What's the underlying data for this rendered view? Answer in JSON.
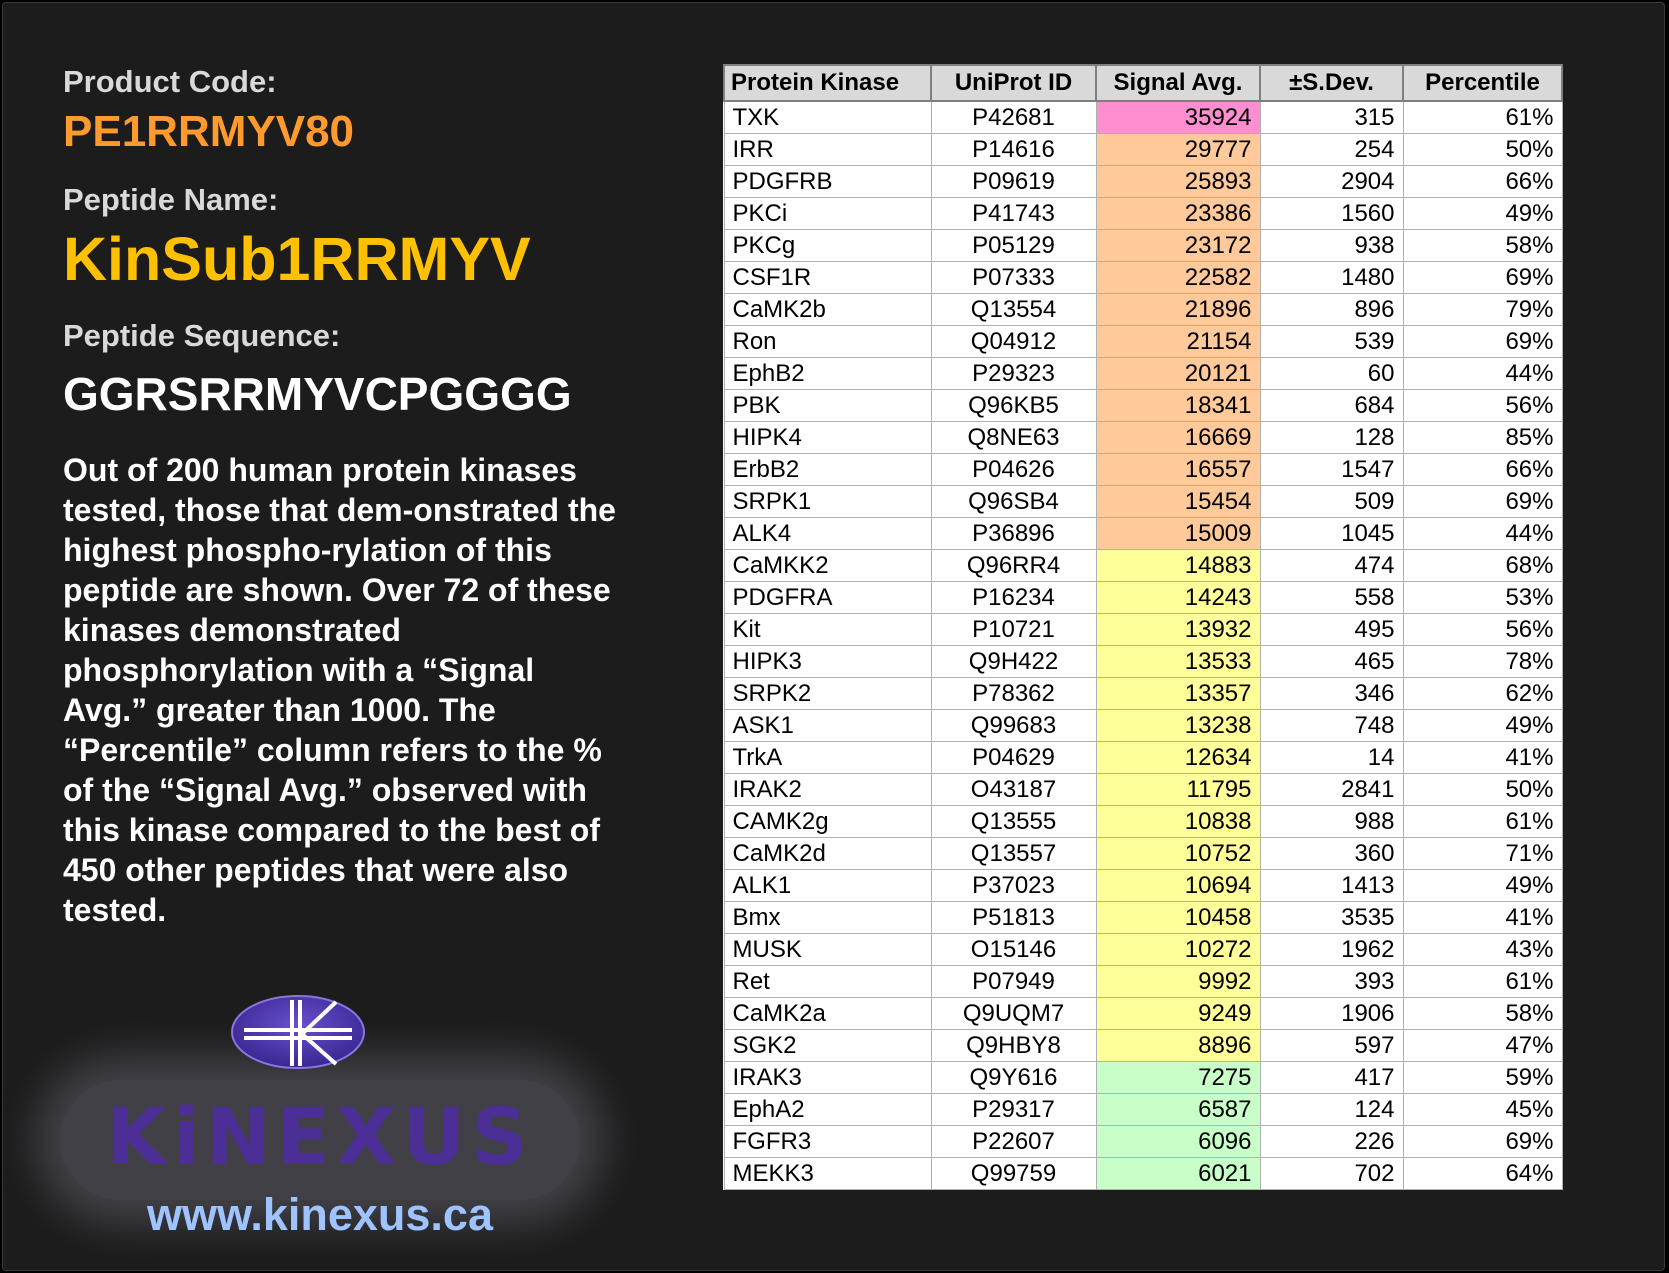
{
  "product": {
    "code_label": "Product Code:",
    "code": "PE1RRMYV80",
    "name_label": "Peptide Name:",
    "name": "KinSub1RRMYV",
    "sequence_label": "Peptide Sequence:",
    "sequence": "GGRSRRMYVCPGGGG",
    "description": "Out of 200 human protein kinases tested, those that dem-onstrated the highest phospho-rylation of this peptide are shown. Over 72 of these kinases demonstrated phosphorylation with a “Signal Avg.” greater than 1000. The “Percentile” column refers to the % of the “Signal Avg.” observed with this kinase compared to the best of 450 other peptides that were also tested."
  },
  "brand": {
    "logo_text": "KiNEXUS",
    "url": "www.kinexus.ca"
  },
  "colors": {
    "pink": "#ff8ed1",
    "orange": "#ffc99a",
    "yellow": "#ffff99",
    "green": "#c8ffc8"
  },
  "table": {
    "headers": [
      "Protein Kinase",
      "UniProt ID",
      "Signal Avg.",
      "±S.Dev.",
      "Percentile"
    ],
    "rows": [
      {
        "kinase": "TXK",
        "uniprot": "P42681",
        "signal": "35924",
        "sdev": "315",
        "pct": "61%",
        "color": "pink"
      },
      {
        "kinase": "IRR",
        "uniprot": "P14616",
        "signal": "29777",
        "sdev": "254",
        "pct": "50%",
        "color": "orange"
      },
      {
        "kinase": "PDGFRB",
        "uniprot": "P09619",
        "signal": "25893",
        "sdev": "2904",
        "pct": "66%",
        "color": "orange"
      },
      {
        "kinase": "PKCi",
        "uniprot": "P41743",
        "signal": "23386",
        "sdev": "1560",
        "pct": "49%",
        "color": "orange"
      },
      {
        "kinase": "PKCg",
        "uniprot": "P05129",
        "signal": "23172",
        "sdev": "938",
        "pct": "58%",
        "color": "orange"
      },
      {
        "kinase": "CSF1R",
        "uniprot": "P07333",
        "signal": "22582",
        "sdev": "1480",
        "pct": "69%",
        "color": "orange"
      },
      {
        "kinase": "CaMK2b",
        "uniprot": "Q13554",
        "signal": "21896",
        "sdev": "896",
        "pct": "79%",
        "color": "orange"
      },
      {
        "kinase": "Ron",
        "uniprot": "Q04912",
        "signal": "21154",
        "sdev": "539",
        "pct": "69%",
        "color": "orange"
      },
      {
        "kinase": "EphB2",
        "uniprot": "P29323",
        "signal": "20121",
        "sdev": "60",
        "pct": "44%",
        "color": "orange"
      },
      {
        "kinase": "PBK",
        "uniprot": "Q96KB5",
        "signal": "18341",
        "sdev": "684",
        "pct": "56%",
        "color": "orange"
      },
      {
        "kinase": "HIPK4",
        "uniprot": "Q8NE63",
        "signal": "16669",
        "sdev": "128",
        "pct": "85%",
        "color": "orange"
      },
      {
        "kinase": "ErbB2",
        "uniprot": "P04626",
        "signal": "16557",
        "sdev": "1547",
        "pct": "66%",
        "color": "orange"
      },
      {
        "kinase": "SRPK1",
        "uniprot": "Q96SB4",
        "signal": "15454",
        "sdev": "509",
        "pct": "69%",
        "color": "orange"
      },
      {
        "kinase": "ALK4",
        "uniprot": "P36896",
        "signal": "15009",
        "sdev": "1045",
        "pct": "44%",
        "color": "orange"
      },
      {
        "kinase": "CaMKK2",
        "uniprot": "Q96RR4",
        "signal": "14883",
        "sdev": "474",
        "pct": "68%",
        "color": "yellow"
      },
      {
        "kinase": "PDGFRA",
        "uniprot": "P16234",
        "signal": "14243",
        "sdev": "558",
        "pct": "53%",
        "color": "yellow"
      },
      {
        "kinase": "Kit",
        "uniprot": "P10721",
        "signal": "13932",
        "sdev": "495",
        "pct": "56%",
        "color": "yellow"
      },
      {
        "kinase": "HIPK3",
        "uniprot": "Q9H422",
        "signal": "13533",
        "sdev": "465",
        "pct": "78%",
        "color": "yellow"
      },
      {
        "kinase": "SRPK2",
        "uniprot": "P78362",
        "signal": "13357",
        "sdev": "346",
        "pct": "62%",
        "color": "yellow"
      },
      {
        "kinase": "ASK1",
        "uniprot": "Q99683",
        "signal": "13238",
        "sdev": "748",
        "pct": "49%",
        "color": "yellow"
      },
      {
        "kinase": "TrkA",
        "uniprot": "P04629",
        "signal": "12634",
        "sdev": "14",
        "pct": "41%",
        "color": "yellow"
      },
      {
        "kinase": "IRAK2",
        "uniprot": "O43187",
        "signal": "11795",
        "sdev": "2841",
        "pct": "50%",
        "color": "yellow"
      },
      {
        "kinase": "CAMK2g",
        "uniprot": "Q13555",
        "signal": "10838",
        "sdev": "988",
        "pct": "61%",
        "color": "yellow"
      },
      {
        "kinase": "CaMK2d",
        "uniprot": "Q13557",
        "signal": "10752",
        "sdev": "360",
        "pct": "71%",
        "color": "yellow"
      },
      {
        "kinase": "ALK1",
        "uniprot": "P37023",
        "signal": "10694",
        "sdev": "1413",
        "pct": "49%",
        "color": "yellow"
      },
      {
        "kinase": "Bmx",
        "uniprot": "P51813",
        "signal": "10458",
        "sdev": "3535",
        "pct": "41%",
        "color": "yellow"
      },
      {
        "kinase": "MUSK",
        "uniprot": "O15146",
        "signal": "10272",
        "sdev": "1962",
        "pct": "43%",
        "color": "yellow"
      },
      {
        "kinase": "Ret",
        "uniprot": "P07949",
        "signal": "9992",
        "sdev": "393",
        "pct": "61%",
        "color": "yellow"
      },
      {
        "kinase": "CaMK2a",
        "uniprot": "Q9UQM7",
        "signal": "9249",
        "sdev": "1906",
        "pct": "58%",
        "color": "yellow"
      },
      {
        "kinase": "SGK2",
        "uniprot": "Q9HBY8",
        "signal": "8896",
        "sdev": "597",
        "pct": "47%",
        "color": "yellow"
      },
      {
        "kinase": "IRAK3",
        "uniprot": "Q9Y616",
        "signal": "7275",
        "sdev": "417",
        "pct": "59%",
        "color": "green"
      },
      {
        "kinase": "EphA2",
        "uniprot": "P29317",
        "signal": "6587",
        "sdev": "124",
        "pct": "45%",
        "color": "green"
      },
      {
        "kinase": "FGFR3",
        "uniprot": "P22607",
        "signal": "6096",
        "sdev": "226",
        "pct": "69%",
        "color": "green"
      },
      {
        "kinase": "MEKK3",
        "uniprot": "Q99759",
        "signal": "6021",
        "sdev": "702",
        "pct": "64%",
        "color": "green"
      }
    ]
  }
}
